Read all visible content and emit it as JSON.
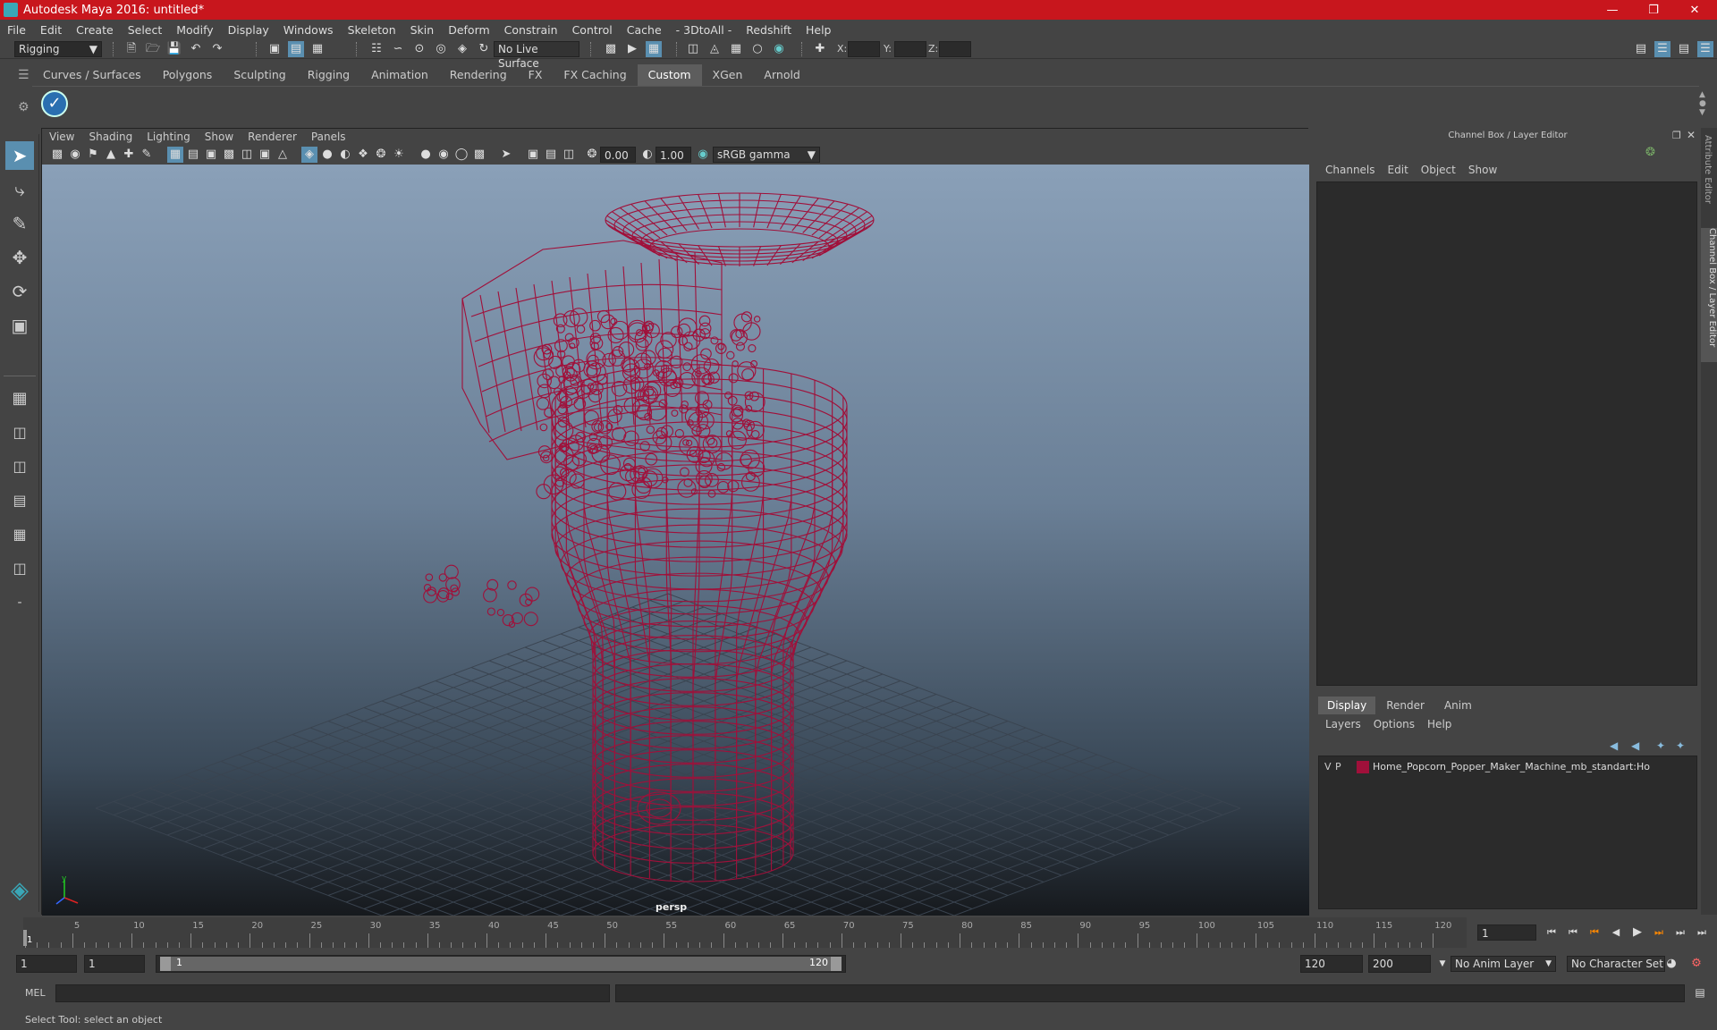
{
  "title": "Autodesk Maya 2016: untitled*",
  "menus": [
    "File",
    "Edit",
    "Create",
    "Select",
    "Modify",
    "Display",
    "Windows",
    "Skeleton",
    "Skin",
    "Deform",
    "Constrain",
    "Control",
    "Cache",
    "- 3DtoAll -",
    "Redshift",
    "Help"
  ],
  "status": {
    "mode": "Rigging",
    "live_surface": "No Live Surface",
    "x_label": "X:",
    "y_label": "Y:",
    "z_label": "Z:"
  },
  "shelf_tabs": [
    "Curves / Surfaces",
    "Polygons",
    "Sculpting",
    "Rigging",
    "Animation",
    "Rendering",
    "FX",
    "FX Caching",
    "Custom",
    "XGen",
    "Arnold"
  ],
  "shelf_active": "Custom",
  "viewport": {
    "menus": [
      "View",
      "Shading",
      "Lighting",
      "Show",
      "Renderer",
      "Panels"
    ],
    "exposure": "0.00",
    "gamma": "1.00",
    "color_space": "sRGB gamma",
    "camera": "persp",
    "wire_color": "#a0103a"
  },
  "channel_box": {
    "title": "Channel Box / Layer Editor",
    "menus": [
      "Channels",
      "Edit",
      "Object",
      "Show"
    ],
    "layer_tabs": [
      "Display",
      "Render",
      "Anim"
    ],
    "layer_tab_active": "Display",
    "layer_menus": [
      "Layers",
      "Options",
      "Help"
    ],
    "layer": {
      "v": "V",
      "p": "P",
      "color": "#a0103a",
      "name": "Home_Popcorn_Popper_Maker_Machine_mb_standart:Ho"
    }
  },
  "side_tabs": [
    "Attribute Editor",
    "Channel Box / Layer Editor"
  ],
  "timeline": {
    "ticks": [
      "5",
      "10",
      "15",
      "20",
      "25",
      "30",
      "35",
      "40",
      "45",
      "50",
      "55",
      "60",
      "65",
      "70",
      "75",
      "80",
      "85",
      "90",
      "95",
      "100",
      "105",
      "110",
      "115",
      "120"
    ],
    "current": "1",
    "current_field": "1"
  },
  "range": {
    "start": "1",
    "playback_start": "1",
    "slider_start": "1",
    "slider_end": "120",
    "playback_end": "120",
    "end": "200",
    "anim_layer": "No Anim Layer",
    "character_set": "No Character Set"
  },
  "command": {
    "lang": "MEL"
  },
  "help_line": "Select Tool: select an object"
}
